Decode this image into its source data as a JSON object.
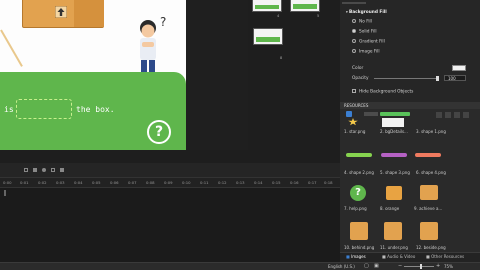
{
  "stage": {
    "sentence_start": "is",
    "sentence_end": "the box.",
    "help_label": "?"
  },
  "properties": {
    "section_title": "Background Fill",
    "fill_options": [
      "No Fill",
      "Solid Fill",
      "Gradient Fill",
      "Image Fill"
    ],
    "color_label": "Color",
    "opacity_label": "Opacity",
    "opacity_value": "100",
    "hide_bg_label": "Hide Background Objects"
  },
  "slides": [
    {
      "number": "4"
    },
    {
      "number": "5"
    },
    {
      "number": "8"
    }
  ],
  "resources": {
    "title": "RESOURCES",
    "assets": [
      {
        "label": "1. star.png"
      },
      {
        "label": "2. bgDetails..."
      },
      {
        "label": "3. shape 1.png"
      },
      {
        "label": "4. shape 2.png"
      },
      {
        "label": "5. shape 3.png"
      },
      {
        "label": "6. shape 4.png"
      },
      {
        "label": "7. help.png"
      },
      {
        "label": "8. orange"
      },
      {
        "label": "9. achieve a..."
      },
      {
        "label": "10. behind.png"
      },
      {
        "label": "11. under.png"
      },
      {
        "label": "12. beside.png"
      }
    ],
    "tabs": [
      "Images",
      "Audio & Video",
      "Other Resources"
    ]
  },
  "timeline": {
    "ticks": [
      "0:00",
      "0:01",
      "0:02",
      "0:03",
      "0:04",
      "0:05",
      "0:06",
      "0:07",
      "0:08",
      "0:09",
      "0:10",
      "0:11",
      "0:12",
      "0:13",
      "0:14",
      "0:15",
      "0:16",
      "0:17",
      "0:18",
      "0:19"
    ]
  },
  "status": {
    "language": "English (U.S.)",
    "zoom": "75%"
  },
  "colors": {
    "stage_green": "#5fb64c",
    "accent_blue": "#2f8bd8"
  }
}
